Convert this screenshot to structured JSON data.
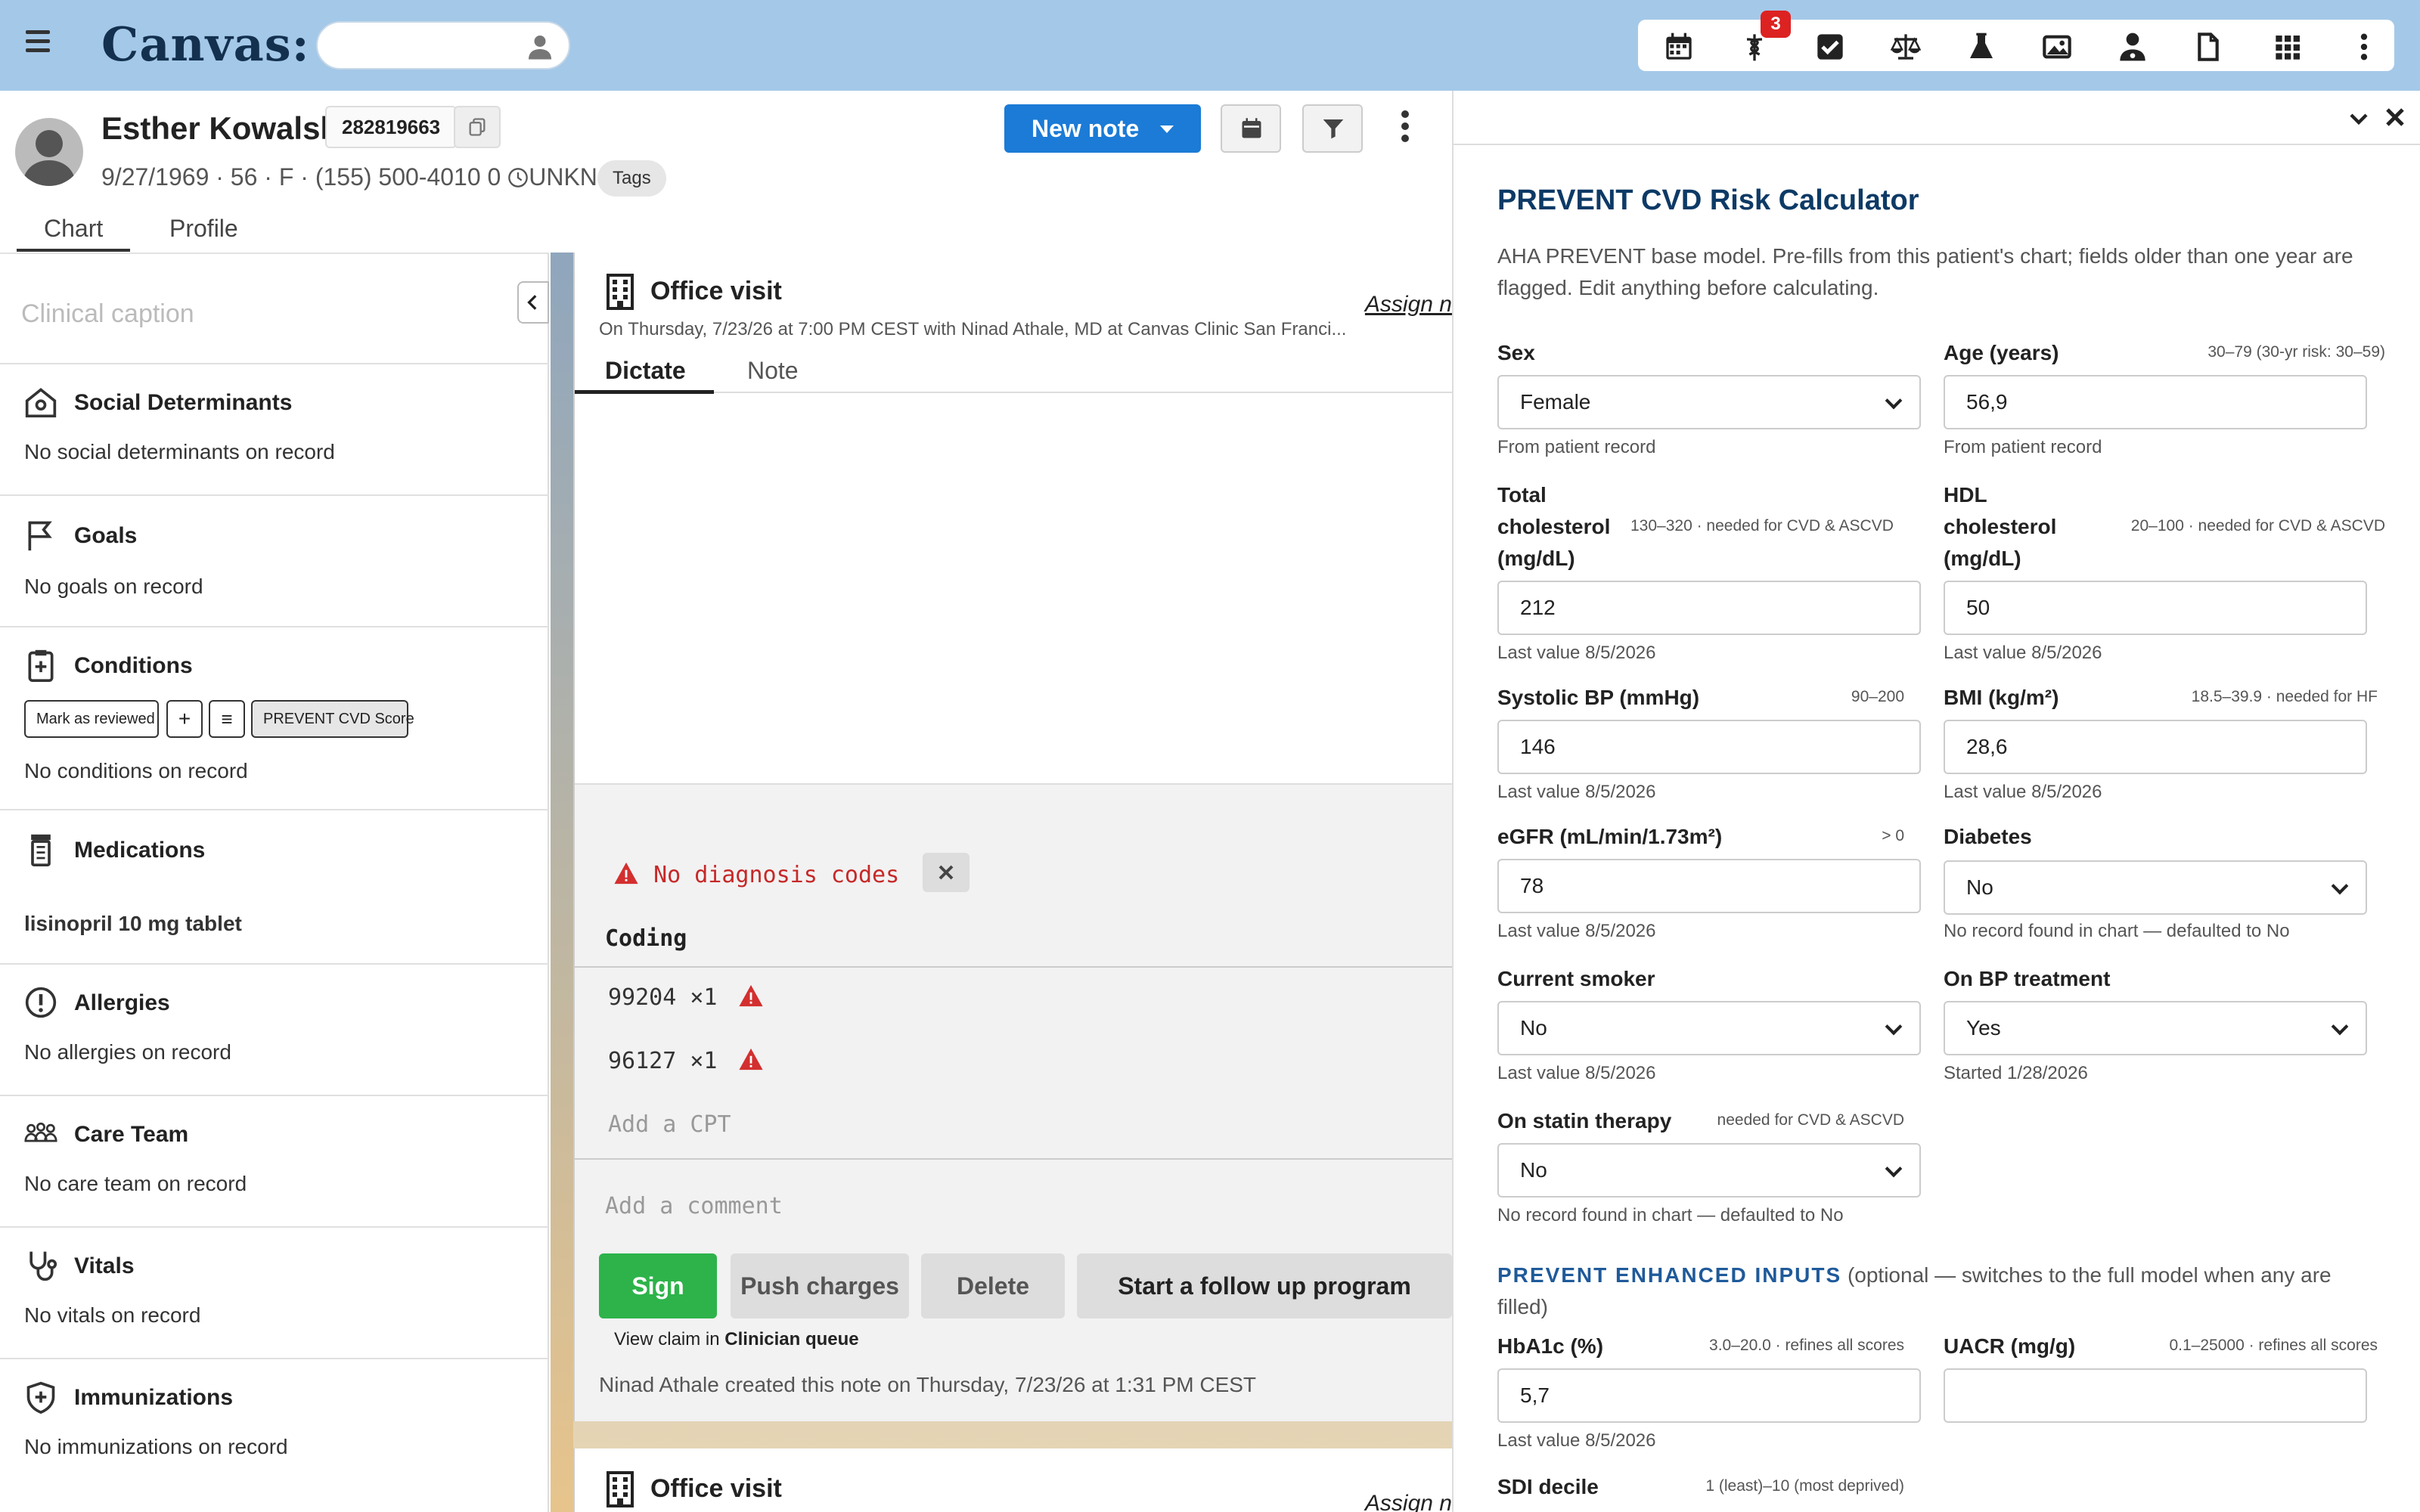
{
  "app": {
    "logo": "Canvas:",
    "notification_count": "3"
  },
  "topbar_icons": [
    "calendar-icon",
    "caduceus-icon",
    "checkbox-icon",
    "scale-icon",
    "flask-icon",
    "image-icon",
    "doctor-icon",
    "document-icon",
    "apps-grid-icon",
    "more-vert-icon"
  ],
  "patient": {
    "name": "Esther Kowalski",
    "mrn": "282819663",
    "info": "9/27/1969 · 56 · F · (155) 500-4010 0",
    "timezone": "UNKN",
    "tags": "Tags",
    "tabs": [
      "Chart",
      "Profile"
    ]
  },
  "header_actions": {
    "new_note": "New note"
  },
  "left": {
    "caption_placeholder": "Clinical caption",
    "sections": [
      {
        "title": "Social Determinants",
        "body": "No social determinants on record",
        "icon": "house-icon"
      },
      {
        "title": "Goals",
        "body": "No goals on record",
        "icon": "flag-icon"
      },
      {
        "title": "Conditions",
        "body": "No conditions on record",
        "icon": "clipboard-plus-icon",
        "buttons": [
          "Mark as reviewed",
          "+",
          "≡",
          "PREVENT CVD Score"
        ]
      },
      {
        "title": "Medications",
        "body": "lisinopril 10 mg tablet",
        "icon": "pill-bottle-icon"
      },
      {
        "title": "Allergies",
        "body": "No allergies on record",
        "icon": "alert-circle-icon"
      },
      {
        "title": "Care Team",
        "body": "No care team on record",
        "icon": "people-icon"
      },
      {
        "title": "Vitals",
        "body": "No vitals on record",
        "icon": "stethoscope-icon"
      },
      {
        "title": "Immunizations",
        "body": "No immunizations on record",
        "icon": "shield-icon"
      }
    ]
  },
  "note": {
    "title": "Office visit",
    "assign": "Assign n",
    "subtitle": "On Thursday, 7/23/26 at 7:00 PM CEST with Ninad Athale, MD at Canvas Clinic San Franci...",
    "tabs": [
      "Dictate",
      "Note"
    ],
    "no_diagnosis": "No diagnosis codes",
    "coding_header": "Coding",
    "codes": [
      "99204 ×1",
      "96127 ×1"
    ],
    "add_cpt": "Add a CPT",
    "add_comment": "Add a comment",
    "buttons": {
      "sign": "Sign",
      "push": "Push charges",
      "delete": "Delete",
      "followup": "Start a follow up program"
    },
    "view_claim_prefix": "View claim in ",
    "view_claim_link": "Clinician queue",
    "created_by": "Ninad Athale created this note on Thursday, 7/23/26 at 1:31 PM CEST",
    "second_title": "Office visit",
    "second_assign": "Assign n"
  },
  "calc": {
    "title": "PREVENT CVD Risk Calculator",
    "desc": "AHA PREVENT base model. Pre-fills from this patient's chart; fields older than one year are flagged. Edit anything before calculating.",
    "sex": {
      "label": "Sex",
      "value": "Female",
      "hint": "From patient record"
    },
    "age": {
      "label": "Age (years)",
      "range": "30–79 (30-yr risk: 30–59)",
      "value": "56,9",
      "hint": "From patient record"
    },
    "tc": {
      "label1": "Total",
      "label2": "cholesterol",
      "label3": "(mg/dL)",
      "range": "130–320 · needed for CVD & ASCVD",
      "value": "212",
      "hint": "Last value 8/5/2026"
    },
    "hdl": {
      "label1": "HDL",
      "label2": "cholesterol",
      "label3": "(mg/dL)",
      "range": "20–100 · needed for CVD & ASCVD",
      "value": "50",
      "hint": "Last value 8/5/2026"
    },
    "sbp": {
      "label": "Systolic BP (mmHg)",
      "range": "90–200",
      "value": "146",
      "hint": "Last value 8/5/2026"
    },
    "bmi": {
      "label": "BMI (kg/m²)",
      "range": "18.5–39.9 · needed for HF",
      "value": "28,6",
      "hint": "Last value 8/5/2026"
    },
    "egfr": {
      "label": "eGFR (mL/min/1.73m²)",
      "range": "> 0",
      "value": "78",
      "hint": "Last value 8/5/2026"
    },
    "diabetes": {
      "label": "Diabetes",
      "value": "No",
      "hint": "No record found in chart — defaulted to No"
    },
    "smoker": {
      "label": "Current smoker",
      "value": "No",
      "hint": "Last value 8/5/2026"
    },
    "bptx": {
      "label": "On BP treatment",
      "value": "Yes",
      "hint": "Started 1/28/2026"
    },
    "statin": {
      "label": "On statin therapy",
      "range": "needed for CVD & ASCVD",
      "value": "No",
      "hint": "No record found in chart — defaulted to No"
    },
    "enhanced_title": "PREVENT ENHANCED INPUTS",
    "enhanced_note": "(optional — switches to the full model when any are filled)",
    "hba1c": {
      "label": "HbA1c (%)",
      "range": "3.0–20.0 · refines all scores",
      "value": "5,7",
      "hint": "Last value 8/5/2026"
    },
    "uacr": {
      "label": "UACR (mg/g)",
      "range": "0.1–25000 · refines all scores",
      "value": ""
    },
    "sdi": {
      "label": "SDI decile",
      "range": "1 (least)–10 (most deprived)"
    }
  }
}
